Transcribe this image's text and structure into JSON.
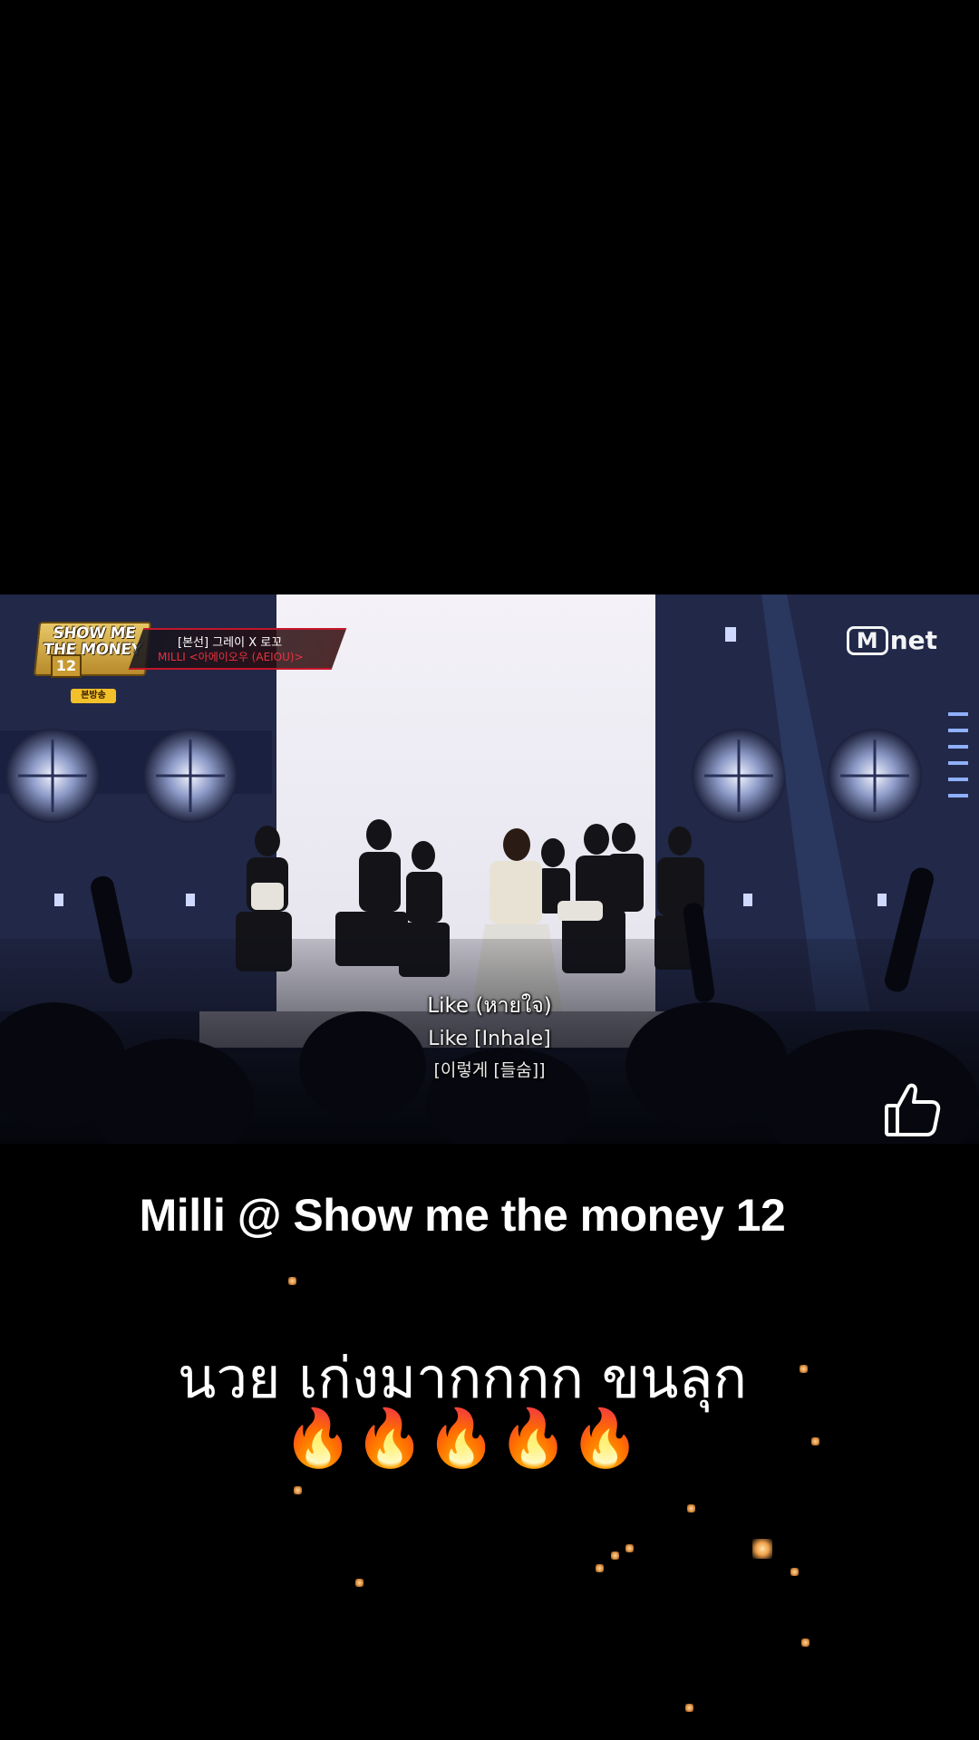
{
  "video": {
    "show_logo": "SHOW ME\nTHE MONEY",
    "show_logo_num": "12",
    "live_tag": "본방송",
    "caption_line1": "[본선] 그레이 X 로꼬",
    "caption_line2": "MILLI <아에이오우 (AEIOU)>",
    "broadcaster": "net",
    "subtitle_thai": "Like (หายใจ)",
    "subtitle_en": "Like [Inhale]",
    "subtitle_ko": "[이렇게 [들숨]]"
  },
  "post": {
    "title": "Milli @ Show me the money 12",
    "body": "นวย เก่งมากกกก ขนลุก",
    "emojis": "🔥🔥🔥🔥🔥"
  },
  "icons": {
    "like": "thumbs-up-icon"
  },
  "colors": {
    "background": "#000000",
    "text": "#ffffff",
    "caption_accent": "#e8323f"
  }
}
